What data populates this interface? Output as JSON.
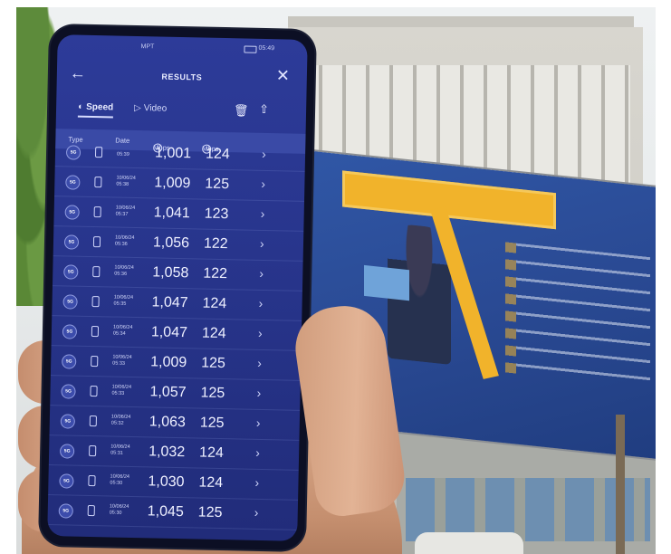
{
  "screen": {
    "status": {
      "carrier": "MPT",
      "time": "05:49"
    },
    "header": {
      "title": "RESULTS",
      "back_icon": "arrow-left-icon",
      "close_icon": "close-icon"
    },
    "tabs": [
      {
        "label": "Speed",
        "icon": "gauge-icon",
        "selected": true
      },
      {
        "label": "Video",
        "icon": "play-icon",
        "selected": false
      }
    ],
    "toolbar": {
      "trash_icon": "trash-icon",
      "share_icon": "share-icon"
    },
    "columns": {
      "type": "Type",
      "date": "Date",
      "download": "Mbps",
      "upload": "Mbps"
    },
    "rows": [
      {
        "badge": "5G",
        "date": "",
        "time": "05:39",
        "download": "1,001",
        "upload": "124"
      },
      {
        "badge": "5G",
        "date": "10/06/24",
        "time": "05:38",
        "download": "1,009",
        "upload": "125"
      },
      {
        "badge": "5G",
        "date": "10/06/24",
        "time": "05:37",
        "download": "1,041",
        "upload": "123"
      },
      {
        "badge": "5G",
        "date": "10/06/24",
        "time": "05:36",
        "download": "1,056",
        "upload": "122"
      },
      {
        "badge": "5G",
        "date": "10/06/24",
        "time": "05:36",
        "download": "1,058",
        "upload": "122"
      },
      {
        "badge": "5G",
        "date": "10/06/24",
        "time": "05:35",
        "download": "1,047",
        "upload": "124"
      },
      {
        "badge": "5G",
        "date": "10/06/24",
        "time": "05:34",
        "download": "1,047",
        "upload": "124"
      },
      {
        "badge": "5G",
        "date": "10/06/24",
        "time": "05:33",
        "download": "1,009",
        "upload": "125"
      },
      {
        "badge": "5G",
        "date": "10/06/24",
        "time": "05:33",
        "download": "1,057",
        "upload": "125"
      },
      {
        "badge": "5G",
        "date": "10/06/24",
        "time": "05:32",
        "download": "1,063",
        "upload": "125"
      },
      {
        "badge": "5G",
        "date": "10/06/24",
        "time": "05:31",
        "download": "1,032",
        "upload": "124"
      },
      {
        "badge": "5G",
        "date": "10/06/24",
        "time": "05:30",
        "download": "1,030",
        "upload": "124"
      },
      {
        "badge": "5G",
        "date": "10/06/24",
        "time": "05:30",
        "download": "1,045",
        "upload": "125"
      }
    ]
  },
  "colors": {
    "screen_bg": "#27348a",
    "header_bar": "#3a4aa6",
    "billboard": "#2a4a94",
    "accent_yellow": "#f1b32b"
  }
}
